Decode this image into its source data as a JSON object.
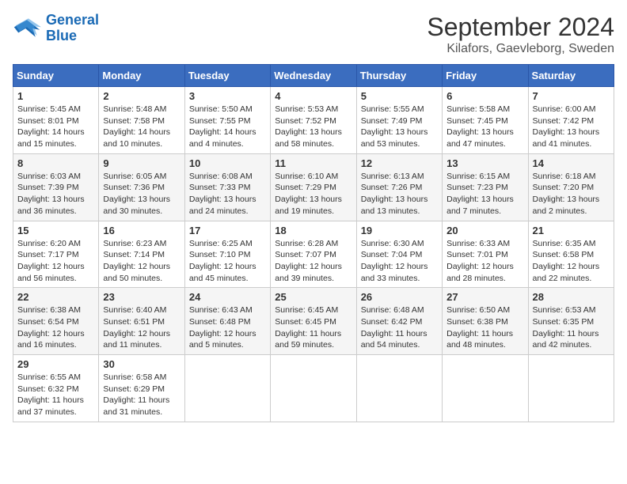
{
  "header": {
    "logo_line1": "General",
    "logo_line2": "Blue",
    "title": "September 2024",
    "subtitle": "Kilafors, Gaevleborg, Sweden"
  },
  "calendar": {
    "headers": [
      "Sunday",
      "Monday",
      "Tuesday",
      "Wednesday",
      "Thursday",
      "Friday",
      "Saturday"
    ],
    "weeks": [
      [
        {
          "day": "1",
          "info": "Sunrise: 5:45 AM\nSunset: 8:01 PM\nDaylight: 14 hours\nand 15 minutes."
        },
        {
          "day": "2",
          "info": "Sunrise: 5:48 AM\nSunset: 7:58 PM\nDaylight: 14 hours\nand 10 minutes."
        },
        {
          "day": "3",
          "info": "Sunrise: 5:50 AM\nSunset: 7:55 PM\nDaylight: 14 hours\nand 4 minutes."
        },
        {
          "day": "4",
          "info": "Sunrise: 5:53 AM\nSunset: 7:52 PM\nDaylight: 13 hours\nand 58 minutes."
        },
        {
          "day": "5",
          "info": "Sunrise: 5:55 AM\nSunset: 7:49 PM\nDaylight: 13 hours\nand 53 minutes."
        },
        {
          "day": "6",
          "info": "Sunrise: 5:58 AM\nSunset: 7:45 PM\nDaylight: 13 hours\nand 47 minutes."
        },
        {
          "day": "7",
          "info": "Sunrise: 6:00 AM\nSunset: 7:42 PM\nDaylight: 13 hours\nand 41 minutes."
        }
      ],
      [
        {
          "day": "8",
          "info": "Sunrise: 6:03 AM\nSunset: 7:39 PM\nDaylight: 13 hours\nand 36 minutes."
        },
        {
          "day": "9",
          "info": "Sunrise: 6:05 AM\nSunset: 7:36 PM\nDaylight: 13 hours\nand 30 minutes."
        },
        {
          "day": "10",
          "info": "Sunrise: 6:08 AM\nSunset: 7:33 PM\nDaylight: 13 hours\nand 24 minutes."
        },
        {
          "day": "11",
          "info": "Sunrise: 6:10 AM\nSunset: 7:29 PM\nDaylight: 13 hours\nand 19 minutes."
        },
        {
          "day": "12",
          "info": "Sunrise: 6:13 AM\nSunset: 7:26 PM\nDaylight: 13 hours\nand 13 minutes."
        },
        {
          "day": "13",
          "info": "Sunrise: 6:15 AM\nSunset: 7:23 PM\nDaylight: 13 hours\nand 7 minutes."
        },
        {
          "day": "14",
          "info": "Sunrise: 6:18 AM\nSunset: 7:20 PM\nDaylight: 13 hours\nand 2 minutes."
        }
      ],
      [
        {
          "day": "15",
          "info": "Sunrise: 6:20 AM\nSunset: 7:17 PM\nDaylight: 12 hours\nand 56 minutes."
        },
        {
          "day": "16",
          "info": "Sunrise: 6:23 AM\nSunset: 7:14 PM\nDaylight: 12 hours\nand 50 minutes."
        },
        {
          "day": "17",
          "info": "Sunrise: 6:25 AM\nSunset: 7:10 PM\nDaylight: 12 hours\nand 45 minutes."
        },
        {
          "day": "18",
          "info": "Sunrise: 6:28 AM\nSunset: 7:07 PM\nDaylight: 12 hours\nand 39 minutes."
        },
        {
          "day": "19",
          "info": "Sunrise: 6:30 AM\nSunset: 7:04 PM\nDaylight: 12 hours\nand 33 minutes."
        },
        {
          "day": "20",
          "info": "Sunrise: 6:33 AM\nSunset: 7:01 PM\nDaylight: 12 hours\nand 28 minutes."
        },
        {
          "day": "21",
          "info": "Sunrise: 6:35 AM\nSunset: 6:58 PM\nDaylight: 12 hours\nand 22 minutes."
        }
      ],
      [
        {
          "day": "22",
          "info": "Sunrise: 6:38 AM\nSunset: 6:54 PM\nDaylight: 12 hours\nand 16 minutes."
        },
        {
          "day": "23",
          "info": "Sunrise: 6:40 AM\nSunset: 6:51 PM\nDaylight: 12 hours\nand 11 minutes."
        },
        {
          "day": "24",
          "info": "Sunrise: 6:43 AM\nSunset: 6:48 PM\nDaylight: 12 hours\nand 5 minutes."
        },
        {
          "day": "25",
          "info": "Sunrise: 6:45 AM\nSunset: 6:45 PM\nDaylight: 11 hours\nand 59 minutes."
        },
        {
          "day": "26",
          "info": "Sunrise: 6:48 AM\nSunset: 6:42 PM\nDaylight: 11 hours\nand 54 minutes."
        },
        {
          "day": "27",
          "info": "Sunrise: 6:50 AM\nSunset: 6:38 PM\nDaylight: 11 hours\nand 48 minutes."
        },
        {
          "day": "28",
          "info": "Sunrise: 6:53 AM\nSunset: 6:35 PM\nDaylight: 11 hours\nand 42 minutes."
        }
      ],
      [
        {
          "day": "29",
          "info": "Sunrise: 6:55 AM\nSunset: 6:32 PM\nDaylight: 11 hours\nand 37 minutes."
        },
        {
          "day": "30",
          "info": "Sunrise: 6:58 AM\nSunset: 6:29 PM\nDaylight: 11 hours\nand 31 minutes."
        },
        {
          "day": "",
          "info": ""
        },
        {
          "day": "",
          "info": ""
        },
        {
          "day": "",
          "info": ""
        },
        {
          "day": "",
          "info": ""
        },
        {
          "day": "",
          "info": ""
        }
      ]
    ]
  }
}
